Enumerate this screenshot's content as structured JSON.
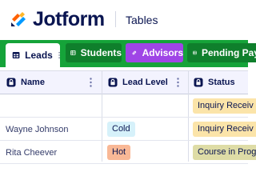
{
  "header": {
    "brand": "Jotform",
    "product": "Tables"
  },
  "tabs": [
    {
      "label": "Leads",
      "icon": "table-icon",
      "active": true
    },
    {
      "label": "Students",
      "icon": "table-icon"
    },
    {
      "label": "Advisors",
      "icon": "link-icon"
    },
    {
      "label": "Pending Pay",
      "icon": "table-icon"
    }
  ],
  "columns": [
    {
      "label": "Name",
      "icon": "lock-icon"
    },
    {
      "label": "Lead Level",
      "icon": "lock-icon"
    },
    {
      "label": "Status",
      "icon": "lock-icon"
    }
  ],
  "rows": [
    {
      "name": "",
      "lead_level": "",
      "status": "Inquiry Receiv"
    },
    {
      "name": "Wayne Johnson",
      "lead_level": "Cold",
      "status": "Inquiry Receiv"
    },
    {
      "name": "Rita Cheever",
      "lead_level": "Hot",
      "status": "Course in Prog"
    }
  ],
  "colors": {
    "brand_navy": "#0a1551",
    "tabbar_green": "#15a339",
    "tab_dark_green": "#0f7f2c",
    "tab_purple": "#9f45e6",
    "chip_cold": "#d6f1fa",
    "chip_hot": "#f9b896",
    "chip_inquiry": "#fbe4a9",
    "chip_course": "#dedca6"
  }
}
